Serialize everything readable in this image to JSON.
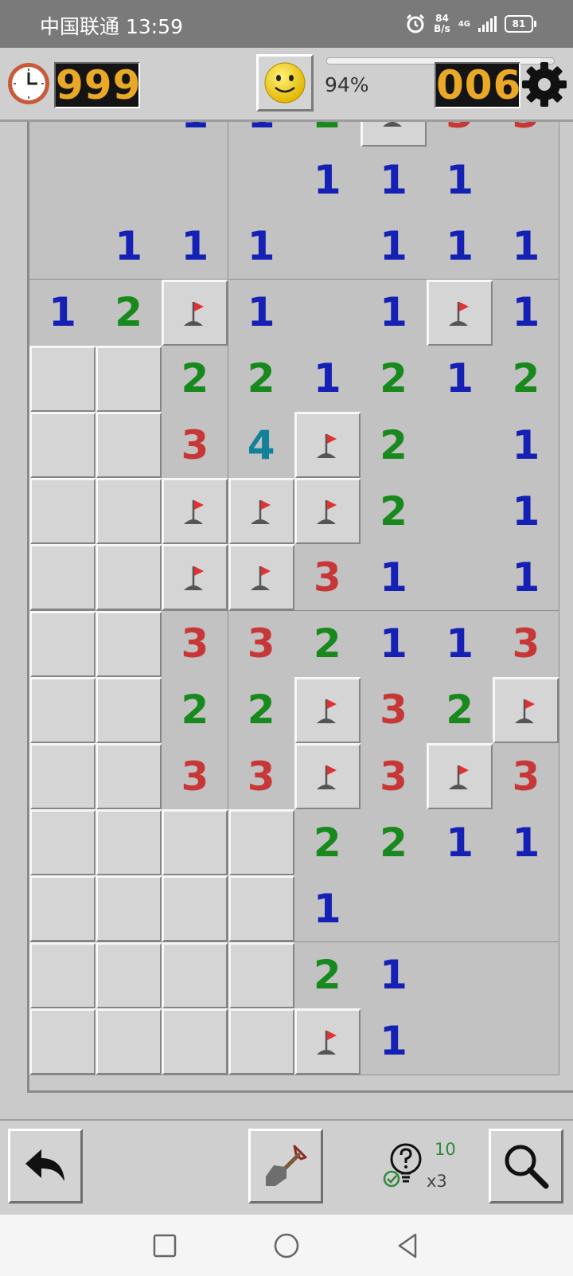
{
  "status_bar": {
    "carrier_time": "中国联通 13:59",
    "net_speed_value": "84",
    "net_speed_unit": "B/s",
    "net_type": "4G",
    "battery": "81"
  },
  "header": {
    "timer": "999",
    "mines_left": "006",
    "progress_text": "94%",
    "progress_value": 94
  },
  "board": {
    "rows": [
      [
        "o",
        "o",
        "1",
        "1",
        "2",
        "F",
        "3",
        "3"
      ],
      [
        "o",
        "o",
        "o",
        "o",
        "1",
        "1",
        "1",
        "o"
      ],
      [
        "o",
        "1",
        "1",
        "1",
        "o",
        "1",
        "1",
        "1"
      ],
      [
        "1",
        "2",
        "F",
        "1",
        "o",
        "1",
        "F",
        "1"
      ],
      [
        "H",
        "H",
        "2",
        "2",
        "1",
        "2",
        "1",
        "2"
      ],
      [
        "H",
        "H",
        "3",
        "4",
        "F",
        "2",
        "o",
        "1"
      ],
      [
        "H",
        "H",
        "F",
        "F",
        "F",
        "2",
        "o",
        "1"
      ],
      [
        "H",
        "H",
        "F",
        "F",
        "3",
        "1",
        "o",
        "1"
      ],
      [
        "H",
        "H",
        "3",
        "3",
        "2",
        "1",
        "1",
        "3"
      ],
      [
        "H",
        "H",
        "2",
        "2",
        "F",
        "3",
        "2",
        "F"
      ],
      [
        "H",
        "H",
        "3",
        "3",
        "F",
        "3",
        "F",
        "3"
      ],
      [
        "H",
        "H",
        "H",
        "H",
        "2",
        "2",
        "1",
        "1"
      ],
      [
        "H",
        "H",
        "H",
        "H",
        "1",
        "o",
        "o",
        "o"
      ],
      [
        "H",
        "H",
        "H",
        "H",
        "2",
        "1",
        "o",
        "o"
      ],
      [
        "H",
        "H",
        "H",
        "H",
        "F",
        "1",
        "o",
        "o"
      ]
    ],
    "legend": {
      "H": "hidden",
      "F": "flag",
      "o": "empty"
    }
  },
  "toolbar": {
    "hint_count": "10",
    "hint_multiplier": "x3"
  },
  "colors": {
    "lcd_digits": "#e9a826",
    "number_1": "#1520b5",
    "number_2": "#18891d",
    "number_3": "#c73737",
    "number_4": "#138197",
    "flag": "#e03232"
  }
}
